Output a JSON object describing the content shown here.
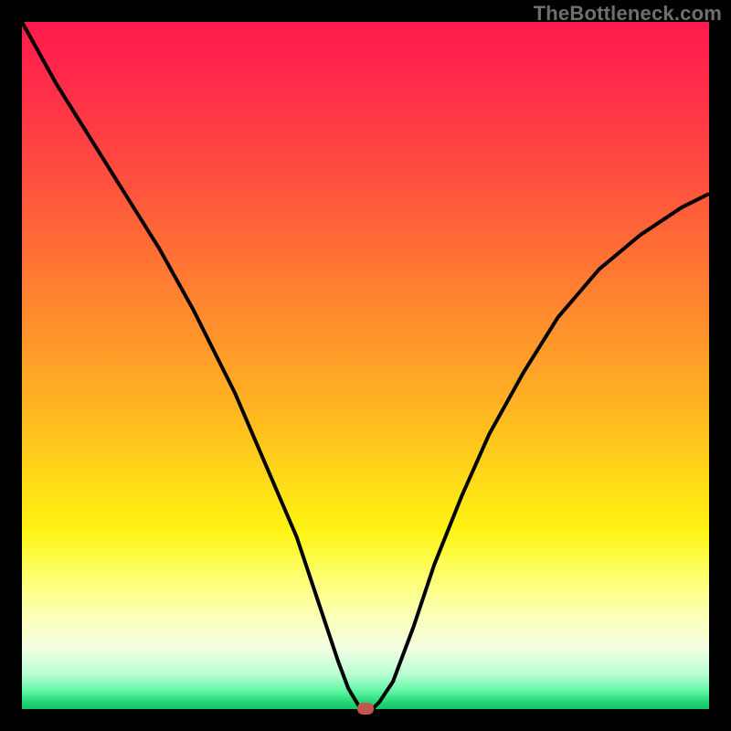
{
  "watermark": "TheBottleneck.com",
  "colors": {
    "curve_stroke": "#000000",
    "marker_fill": "#c0584e",
    "frame_bg": "#000000"
  },
  "chart_data": {
    "type": "line",
    "title": "",
    "xlabel": "",
    "ylabel": "",
    "xlim": [
      0,
      100
    ],
    "ylim": [
      0,
      100
    ],
    "grid": false,
    "legend": false,
    "series": [
      {
        "name": "bottleneck_curve",
        "x": [
          0,
          5,
          10,
          15,
          20,
          25,
          28,
          31,
          34,
          37,
          40,
          42,
          44,
          46,
          47.5,
          49,
          50,
          51,
          52,
          54,
          57,
          60,
          64,
          68,
          73,
          78,
          84,
          90,
          96,
          100
        ],
        "y": [
          100,
          91,
          83,
          75,
          67,
          58,
          52,
          46,
          39,
          32,
          25,
          19,
          13,
          7,
          3,
          0.5,
          0,
          0,
          1,
          4,
          12,
          21,
          31,
          40,
          49,
          57,
          64,
          69,
          73,
          75
        ]
      }
    ],
    "marker": {
      "x": 50,
      "y": 0
    }
  }
}
